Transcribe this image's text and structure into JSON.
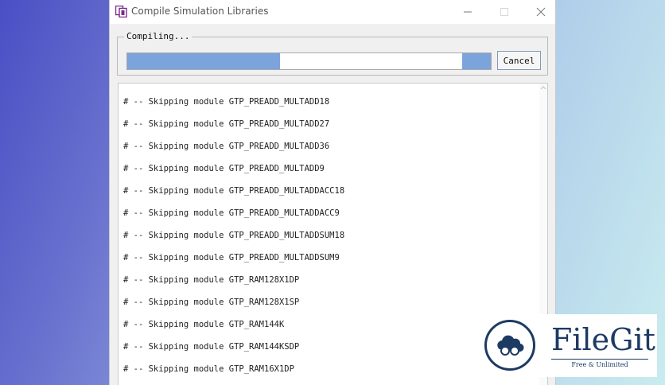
{
  "window": {
    "title": "Compile Simulation Libraries",
    "minimize_icon": "minimize-icon",
    "maximize_icon": "maximize-icon",
    "close_icon": "close-icon"
  },
  "progress": {
    "group_label": "Compiling...",
    "percent": 42,
    "cancel_label": "Cancel"
  },
  "log": {
    "lines": [
      "# -- Skipping module GTP_PREADD_MULTADD18",
      "# -- Skipping module GTP_PREADD_MULTADD27",
      "# -- Skipping module GTP_PREADD_MULTADD36",
      "# -- Skipping module GTP_PREADD_MULTADD9",
      "# -- Skipping module GTP_PREADD_MULTADDACC18",
      "# -- Skipping module GTP_PREADD_MULTADDACC9",
      "# -- Skipping module GTP_PREADD_MULTADDSUM18",
      "# -- Skipping module GTP_PREADD_MULTADDSUM9",
      "# -- Skipping module GTP_RAM128X1DP",
      "# -- Skipping module GTP_RAM128X1SP",
      "# -- Skipping module GTP_RAM144K",
      "# -- Skipping module GTP_RAM144KSDP",
      "# -- Skipping module GTP_RAM16X1DP"
    ]
  },
  "watermark": {
    "name": "FileGit",
    "tagline": "Free & Unlimited"
  }
}
